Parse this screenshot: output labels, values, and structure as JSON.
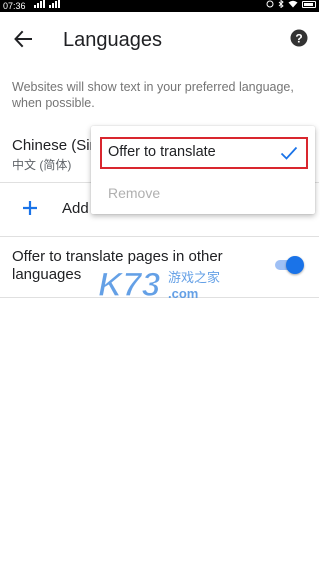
{
  "status_bar": {
    "time": "07:36",
    "signal_left": "4G 4G",
    "icons": [
      "alarm-icon",
      "bluetooth-icon",
      "wifi-icon",
      "battery-icon"
    ]
  },
  "app_bar": {
    "title": "Languages",
    "back_icon": "arrow-back-icon",
    "help_icon": "help-icon"
  },
  "description": "Websites will show text in your preferred language, when possible.",
  "languages": [
    {
      "name": "Chinese (Sim",
      "native": "中文 (简体)"
    }
  ],
  "add_language": {
    "label": "Add",
    "icon": "plus-icon"
  },
  "offer_translate": {
    "label": "Offer to translate pages in other languages",
    "enabled": true
  },
  "menu": {
    "items": [
      {
        "label": "Offer to translate",
        "checked": true,
        "enabled": true
      },
      {
        "label": "Remove",
        "enabled": false
      }
    ]
  },
  "watermark": {
    "text": "K73",
    "subtext": "游戏之家",
    "domain": ".com"
  },
  "colors": {
    "accent": "#1a73e8",
    "highlight_border": "#d9262e",
    "watermark": "#4a90e2"
  }
}
